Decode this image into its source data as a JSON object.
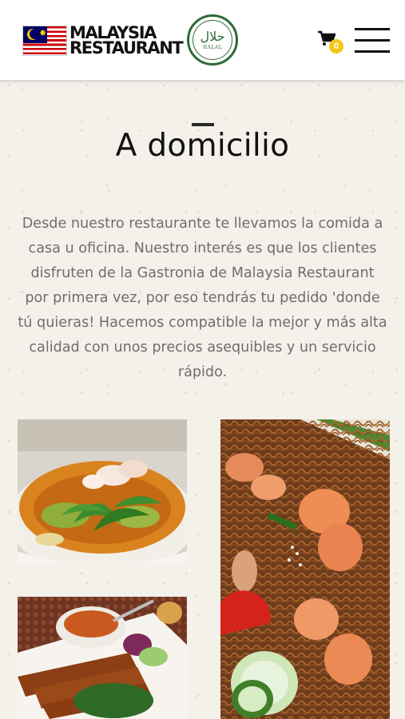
{
  "header": {
    "logo_line1": "MALAYSIA",
    "logo_line2": "RESTAURANT",
    "halal_arabic": "حلال",
    "halal_latin": "HALAL",
    "cart_icon": "cart-icon",
    "cart_count": "0",
    "menu_icon": "hamburger-menu-icon"
  },
  "main": {
    "title": "A domicilio",
    "intro": "Desde nuestro restaurante te llevamos la comida a casa u oficina. Nuestro interés es que los clientes disfruten de la Gastronia de Malaysia Restaurant por primera vez, por eso tendrás tu pedido 'donde tú quieras! Hacemos compatible la mejor y más alta calidad con unos precios asequibles y un servicio rápido."
  },
  "gallery": [
    {
      "name": "curry-soup-photo"
    },
    {
      "name": "fried-noodles-prawns-photo"
    },
    {
      "name": "satay-skewers-photo"
    }
  ],
  "colors": {
    "background": "#f4f0ea",
    "text_gray": "#6e6e6e",
    "halal_green": "#2e6b3a",
    "badge_yellow": "#f5c518"
  }
}
